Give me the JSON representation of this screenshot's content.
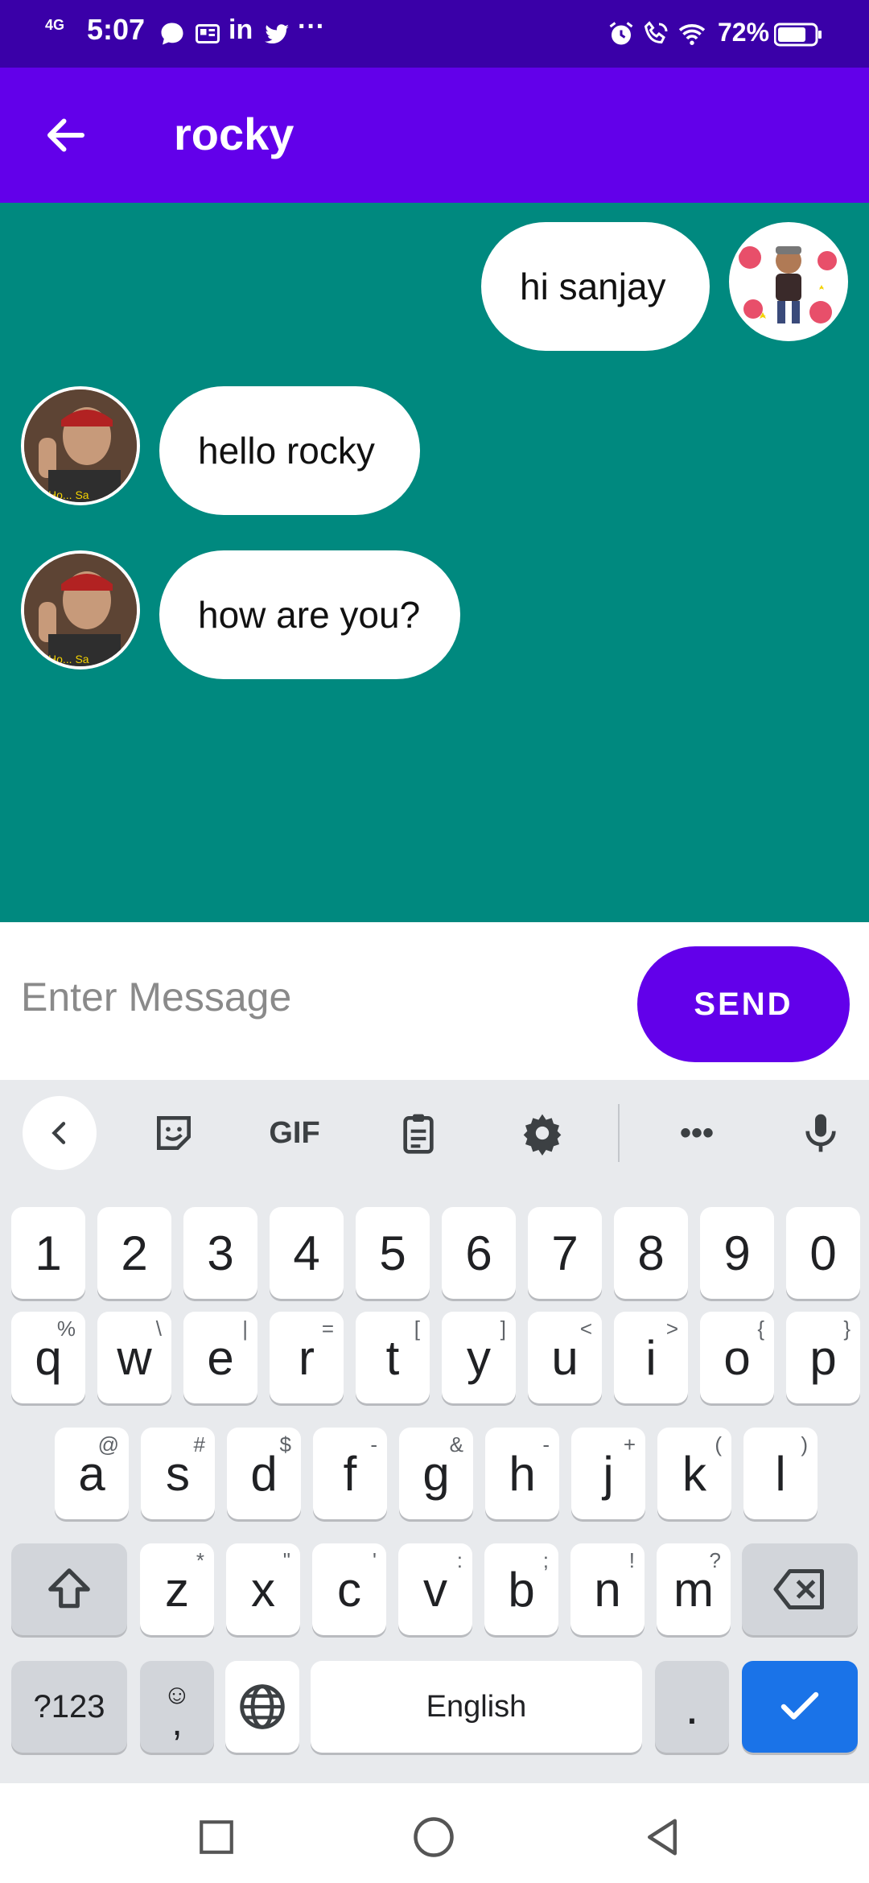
{
  "status_bar": {
    "network": "4G",
    "time": "5:07",
    "battery_percent": "72%",
    "notification_icons": [
      "chat-icon",
      "news-icon",
      "linkedin-icon",
      "twitter-icon",
      "more-icon"
    ],
    "system_icons": [
      "alarm-icon",
      "wifi-call-icon",
      "wifi-icon",
      "battery-icon"
    ]
  },
  "app_bar": {
    "title": "rocky"
  },
  "messages": [
    {
      "text": "hi sanjay",
      "side": "right"
    },
    {
      "text": "hello rocky",
      "side": "left"
    },
    {
      "text": "how are you?",
      "side": "left"
    }
  ],
  "composer": {
    "placeholder": "Enter Message",
    "send_label": "SEND"
  },
  "keyboard": {
    "number_row": [
      "1",
      "2",
      "3",
      "4",
      "5",
      "6",
      "7",
      "8",
      "9",
      "0"
    ],
    "row1": [
      [
        "q",
        "%"
      ],
      [
        "w",
        "\\"
      ],
      [
        "e",
        "|"
      ],
      [
        "r",
        "="
      ],
      [
        "t",
        "["
      ],
      [
        "y",
        "]"
      ],
      [
        "u",
        "<"
      ],
      [
        "i",
        ">"
      ],
      [
        "o",
        "{"
      ],
      [
        "p",
        "}"
      ]
    ],
    "row2": [
      [
        "a",
        "@"
      ],
      [
        "s",
        "#"
      ],
      [
        "d",
        "$"
      ],
      [
        "f",
        "-"
      ],
      [
        "g",
        "&"
      ],
      [
        "h",
        "-"
      ],
      [
        "j",
        "+"
      ],
      [
        "k",
        "("
      ],
      [
        "l",
        ")"
      ]
    ],
    "row3": [
      [
        "z",
        "*"
      ],
      [
        "x",
        "\""
      ],
      [
        "c",
        "'"
      ],
      [
        "v",
        ":"
      ],
      [
        "b",
        ";"
      ],
      [
        "n",
        "!"
      ],
      [
        "m",
        "?"
      ]
    ],
    "symbols_label": "?123",
    "emoji_label": "☺",
    "comma_label": ",",
    "space_label": "English",
    "period_label": ".",
    "toolbar_gif": "GIF"
  },
  "colors": {
    "status_bar": "#3a00a8",
    "app_bar": "#6200ea",
    "chat_bg": "#00897f",
    "send_button": "#6200ea",
    "enter_key": "#1a73e8"
  }
}
